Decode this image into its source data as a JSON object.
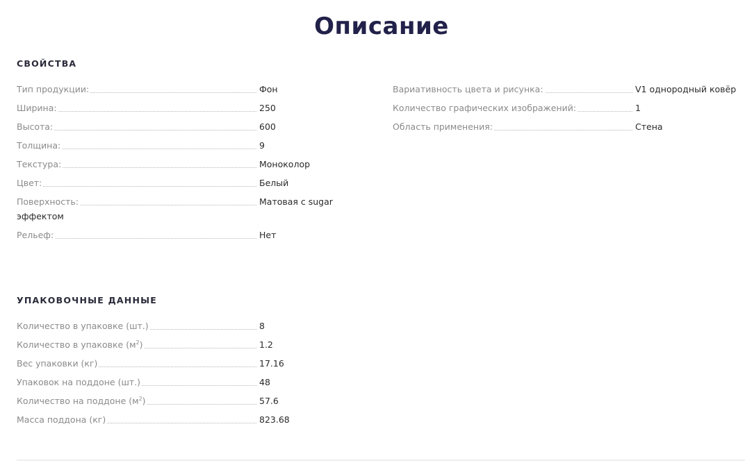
{
  "page": {
    "title": "Описание"
  },
  "properties": {
    "heading": "свойства",
    "left": [
      {
        "label": "Тип продукции:",
        "value": "Фон"
      },
      {
        "label": "Ширина:",
        "value": "250"
      },
      {
        "label": "Высота:",
        "value": "600"
      },
      {
        "label": "Толщина:",
        "value": "9"
      },
      {
        "label": "Текстура:",
        "value": "Моноколор"
      },
      {
        "label": "Цвет:",
        "value": "Белый"
      },
      {
        "label": "Поверхность:",
        "value": "Матовая с sugar",
        "value_cont": "эффектом"
      },
      {
        "label": "Рельеф:",
        "value": "Нет"
      }
    ],
    "right": [
      {
        "label": "Вариативность цвета и рисунка:",
        "value": "V1 однородный ковёр"
      },
      {
        "label": "Количество графических изображений:",
        "value": "1"
      },
      {
        "label": "Область применения:",
        "value": "Стена"
      }
    ]
  },
  "packaging": {
    "heading": "упаковочные данные",
    "rows": [
      {
        "label": "Количество в упаковке (шт.)",
        "value": "8"
      },
      {
        "label": "Количество в упаковке (м",
        "sup": "2",
        "label_end": ")",
        "value": "1.2"
      },
      {
        "label": "Вес упаковки (кг)",
        "value": "17.16"
      },
      {
        "label": "Упаковок на поддоне (шт.)",
        "value": "48"
      },
      {
        "label": "Количество на поддоне (м",
        "sup": "2",
        "label_end": ")",
        "value": "57.6"
      },
      {
        "label": "Масса поддона (кг)",
        "value": "823.68"
      }
    ]
  }
}
